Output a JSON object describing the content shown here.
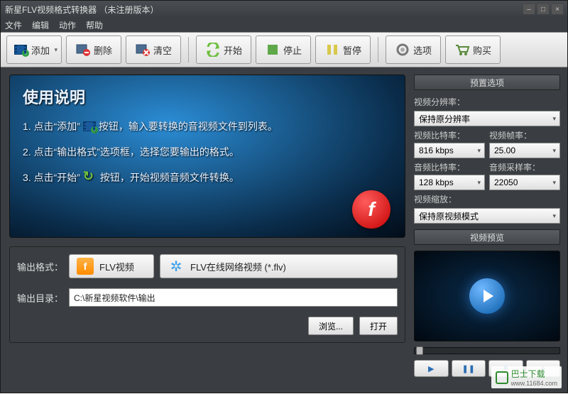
{
  "window": {
    "title": "新星FLV视频格式转换器  （未注册版本）"
  },
  "menubar": {
    "file": "文件",
    "edit": "编辑",
    "action": "动作",
    "help": "帮助"
  },
  "toolbar": {
    "add": "添加",
    "remove": "删除",
    "clear": "清空",
    "start": "开始",
    "stop": "停止",
    "pause": "暂停",
    "options": "选项",
    "buy": "购买"
  },
  "instructions": {
    "heading": "使用说明",
    "step1a": "1. 点击“添加”",
    "step1b": "按钮，输入要转换的音视频文件到列表。",
    "step2": "2. 点击“输出格式”选项框，选择您要输出的格式。",
    "step3a": "3. 点击“开始”",
    "step3b": "按钮，开始视频音频文件转换。"
  },
  "output": {
    "format_label": "输出格式：",
    "format_short": "FLV视频",
    "format_long": "FLV在线网络视频 (*.flv)",
    "dir_label": "输出目录：",
    "dir_value": "C:\\新星视频软件\\输出",
    "browse": "浏览...",
    "open": "打开"
  },
  "presets": {
    "header": "预置选项",
    "resolution_label": "视频分辨率：",
    "resolution_value": "保持原分辨率",
    "vbitrate_label": "视频比特率：",
    "vbitrate_value": "816 kbps",
    "fps_label": "视频帧率：",
    "fps_value": "25.00",
    "abitrate_label": "音频比特率：",
    "abitrate_value": "128 kbps",
    "asample_label": "音频采样率：",
    "asample_value": "22050",
    "scale_label": "视频缩放：",
    "scale_value": "保持原视频模式"
  },
  "preview": {
    "header": "视频预览"
  },
  "watermark": {
    "text": "巴士下载",
    "url": "www.11684.com"
  }
}
